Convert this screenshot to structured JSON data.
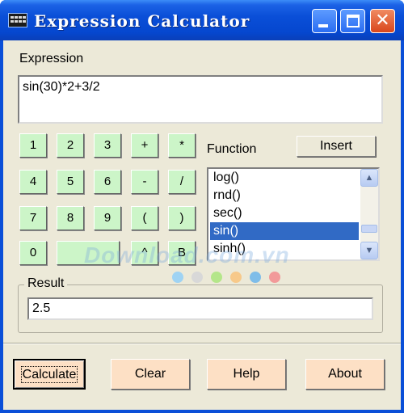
{
  "window": {
    "title": "Expression Calculator"
  },
  "expression": {
    "label": "Expression",
    "value": "sin(30)*2+3/2"
  },
  "keypad": {
    "keys": [
      "1",
      "2",
      "3",
      "+",
      "*",
      "4",
      "5",
      "6",
      "-",
      "/",
      "7",
      "8",
      "9",
      "(",
      ")",
      "0",
      "",
      "^",
      "B"
    ]
  },
  "function": {
    "label": "Function",
    "insert_label": "Insert",
    "items": [
      "log()",
      "rnd()",
      "sec()",
      "sin()",
      "sinh()"
    ],
    "selected": "sin()"
  },
  "result": {
    "label": "Result",
    "value": "2.5"
  },
  "actions": {
    "calculate": "Calculate",
    "clear": "Clear",
    "help": "Help",
    "about": "About"
  },
  "watermark": {
    "text": "Download.com.vn"
  },
  "colors": {
    "title_bar": "#0a4fd8",
    "client_bg": "#ece9d8",
    "key_bg": "#ccf5c8",
    "action_bg": "#fde0c5",
    "selection": "#316ac5",
    "dots": [
      "#9fd3f3",
      "#d8d8d8",
      "#b4e68a",
      "#f7c98a",
      "#7fbde9",
      "#f29a9a"
    ]
  },
  "icons": {
    "app": "calculator-keyboard-icon",
    "minimize": "minimize-icon",
    "maximize": "maximize-icon",
    "close": "close-icon",
    "scroll_up": "chevron-up-icon",
    "scroll_down": "chevron-down-icon"
  }
}
